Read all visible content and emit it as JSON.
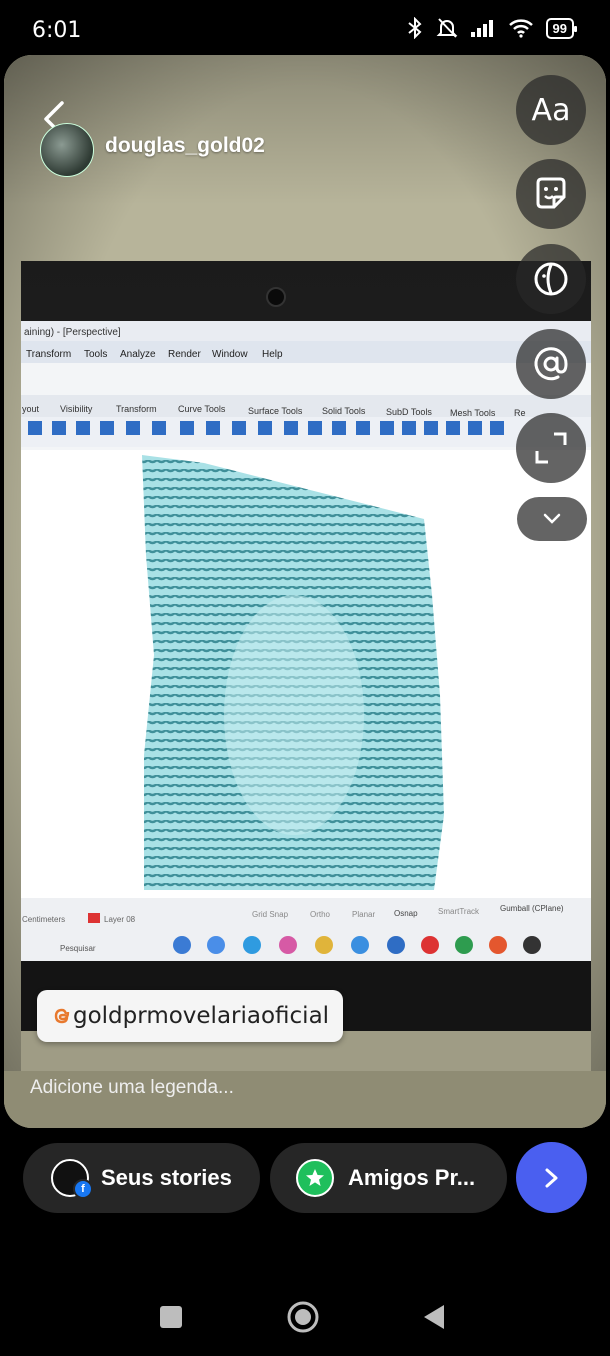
{
  "status_bar": {
    "time": "6:01",
    "battery": "99"
  },
  "story": {
    "username": "douglas_gold02",
    "mention": "goldprmovelariaoficial",
    "caption_placeholder": "Adicione uma legenda...",
    "tools": {
      "text_label": "Aa"
    }
  },
  "photo_content": {
    "title_bar": "aining) - [Perspective]",
    "menu": [
      "Transform",
      "Tools",
      "Analyze",
      "Render",
      "Window",
      "Help"
    ],
    "tabs": [
      "yout",
      "Visibility",
      "Transform",
      "Curve Tools",
      "Surface Tools",
      "Solid Tools",
      "SubD Tools",
      "Mesh Tools",
      "Re"
    ],
    "status_items": [
      "Grid Snap",
      "Ortho",
      "Planar",
      "Osnap",
      "SmartTrack",
      "Gumball (CPlane)"
    ],
    "layer": "Layer 08",
    "units": "Centimeters",
    "search": "Pesquisar"
  },
  "bottom": {
    "your_stories": "Seus stories",
    "close_friends": "Amigos Pr..."
  },
  "colors": {
    "send_button": "#4a5ff0",
    "pill_bg": "#262626",
    "close_friends_green": "#1fbf5c",
    "model_cyan": "#8fd7de"
  }
}
